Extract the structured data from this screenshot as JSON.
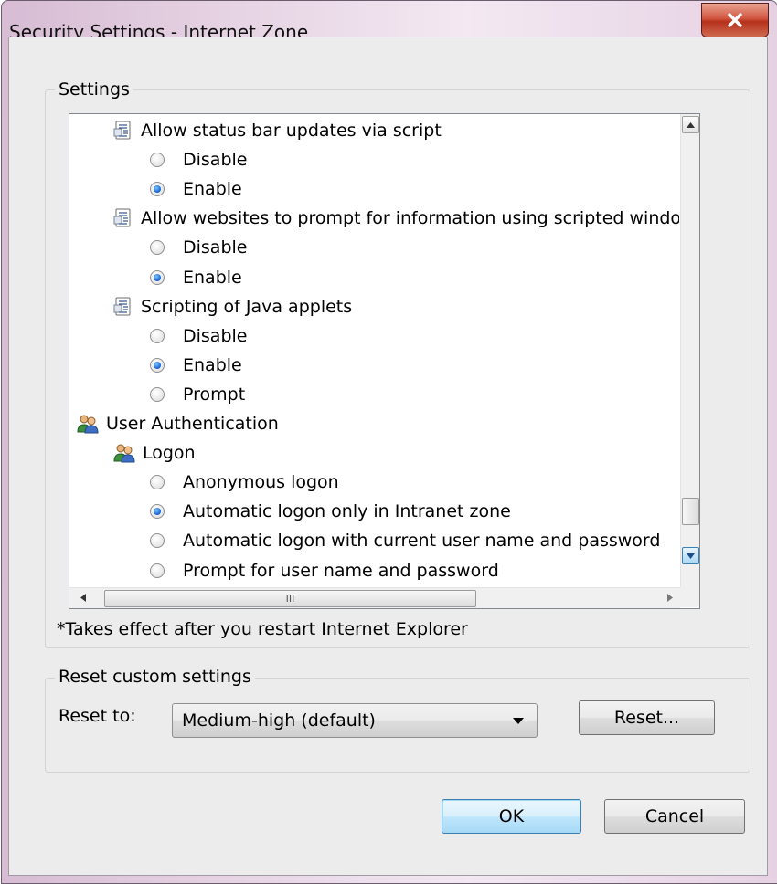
{
  "window": {
    "title": "Security Settings - Internet Zone"
  },
  "settings": {
    "legend": "Settings",
    "rows": [
      {
        "type": "setting",
        "label": "Allow status bar updates via script"
      },
      {
        "type": "radio",
        "label": "Disable",
        "checked": false
      },
      {
        "type": "radio",
        "label": "Enable",
        "checked": true
      },
      {
        "type": "setting",
        "label": "Allow websites to prompt for information using scripted windo"
      },
      {
        "type": "radio",
        "label": "Disable",
        "checked": false
      },
      {
        "type": "radio",
        "label": "Enable",
        "checked": true
      },
      {
        "type": "setting",
        "label": "Scripting of Java applets"
      },
      {
        "type": "radio",
        "label": "Disable",
        "checked": false
      },
      {
        "type": "radio",
        "label": "Enable",
        "checked": true
      },
      {
        "type": "radio",
        "label": "Prompt",
        "checked": false
      },
      {
        "type": "category",
        "label": "User Authentication"
      },
      {
        "type": "subcategory",
        "label": "Logon"
      },
      {
        "type": "radio2",
        "label": "Anonymous logon",
        "checked": false
      },
      {
        "type": "radio2",
        "label": "Automatic logon only in Intranet zone",
        "checked": true
      },
      {
        "type": "radio2",
        "label": "Automatic logon with current user name and password",
        "checked": false
      },
      {
        "type": "radio2",
        "label": "Prompt for user name and password",
        "checked": false
      }
    ],
    "hscroll_thumb_grip": "III",
    "note": "*Takes effect after you restart Internet Explorer"
  },
  "reset": {
    "legend": "Reset custom settings",
    "reset_to_label": "Reset to:",
    "selected": "Medium-high (default)",
    "reset_button": "Reset..."
  },
  "footer": {
    "ok": "OK",
    "cancel": "Cancel"
  },
  "icons": {
    "close": "close-icon",
    "setting": "script-document-icon",
    "category": "users-icon"
  }
}
